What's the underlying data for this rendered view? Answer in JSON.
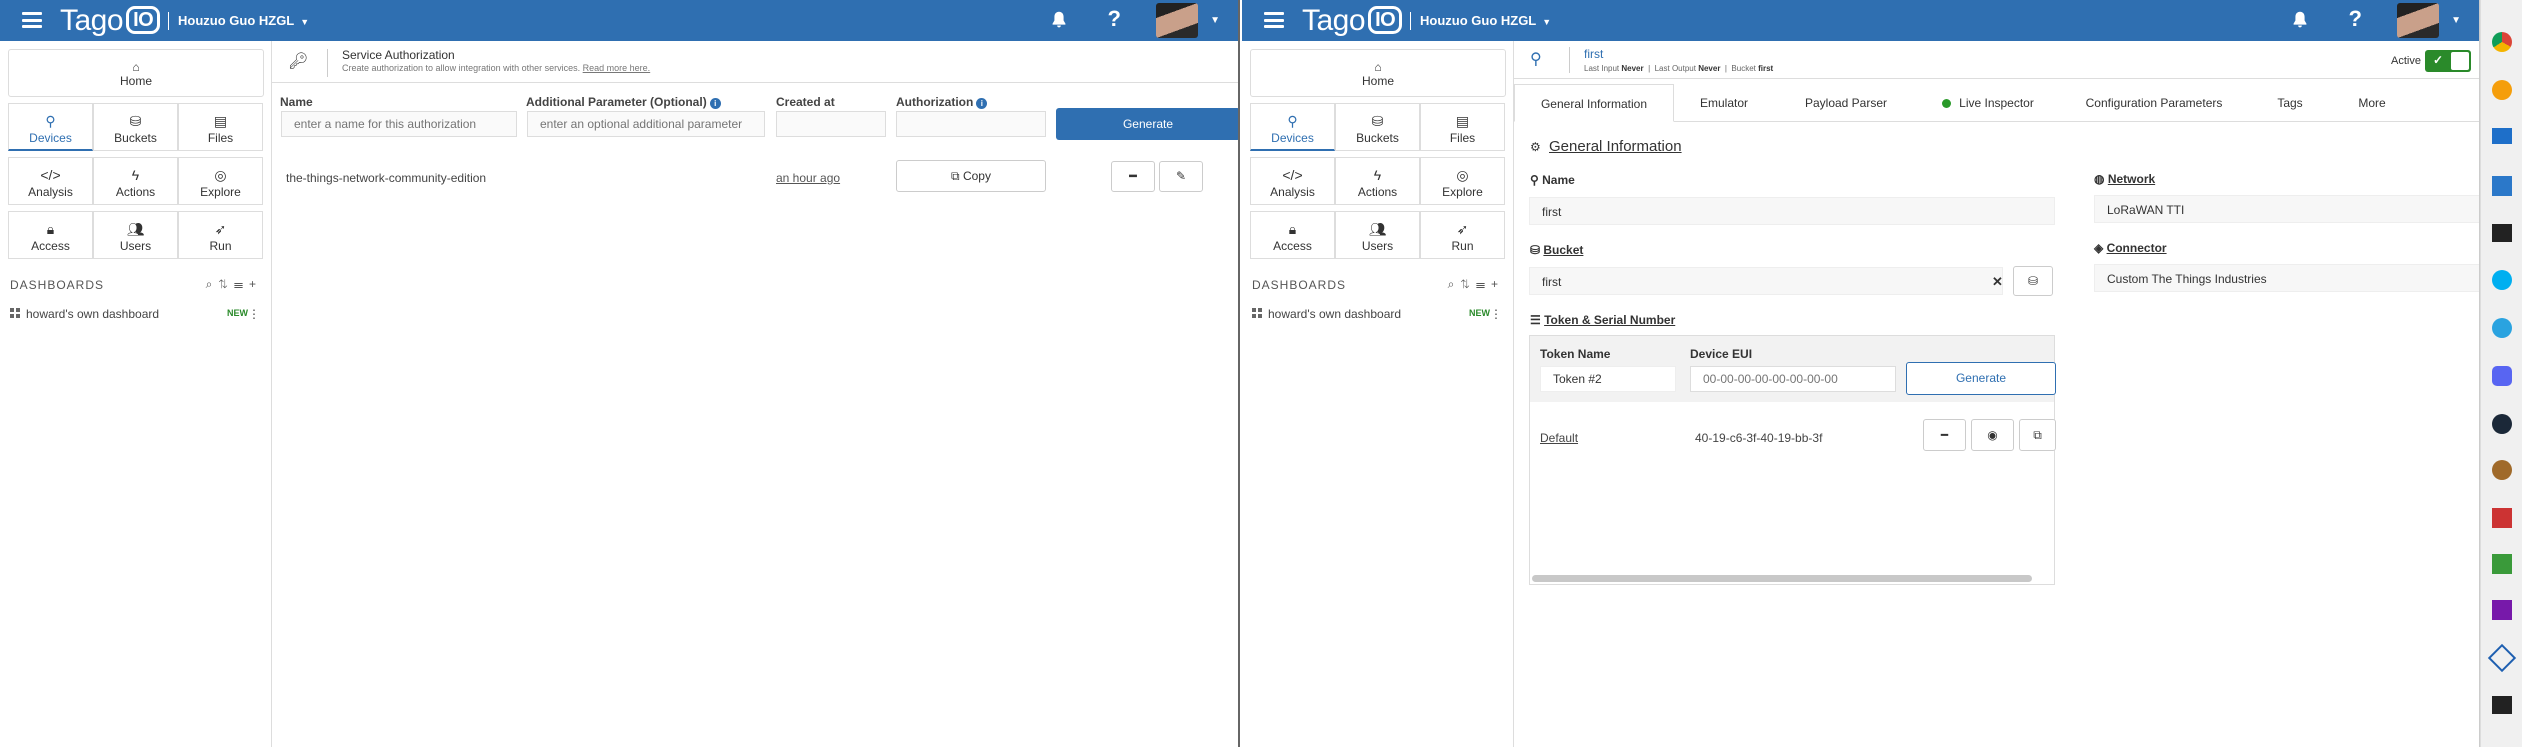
{
  "header": {
    "brand": "Tago",
    "brand_io": "IO",
    "tenant": "Houzuo Guo HZGL"
  },
  "sidebar": {
    "home": "Home",
    "tiles": [
      "Devices",
      "Buckets",
      "Files",
      "Analysis",
      "Actions",
      "Explore",
      "Access",
      "Users",
      "Run"
    ],
    "dashboards_title": "DASHBOARDS",
    "dashboard_item": "howard's own dashboard",
    "dashboard_badge": "NEW"
  },
  "service_auth": {
    "title": "Service Authorization",
    "subtitle": "Create authorization to allow integration with other services.",
    "read_more": "Read more here.",
    "labels": {
      "name": "Name",
      "additional": "Additional Parameter (Optional)",
      "created": "Created at",
      "authorization": "Authorization"
    },
    "placeholders": {
      "name": "enter a name for this authorization",
      "additional": "enter an optional additional parameter"
    },
    "generate": "Generate",
    "row": {
      "name": "the-things-network-community-edition",
      "created": "an hour ago",
      "copy": "Copy"
    }
  },
  "device": {
    "name": "first",
    "meta": {
      "last_input_label": "Last Input",
      "last_input": "Never",
      "last_output_label": "Last Output",
      "last_output": "Never",
      "bucket_label": "Bucket",
      "bucket": "first"
    },
    "active_label": "Active",
    "tabs": [
      "General Information",
      "Emulator",
      "Payload Parser",
      "Live Inspector",
      "Configuration Parameters",
      "Tags",
      "More"
    ],
    "section_title": "General Information",
    "name_label": "Name",
    "name_value": "first",
    "bucket_label": "Bucket",
    "bucket_value": "first",
    "token_label": "Token & Serial Number",
    "token_name_label": "Token Name",
    "device_eui_label": "Device EUI",
    "token_name_value": "Token #2",
    "device_eui_placeholder": "00-00-00-00-00-00-00-00",
    "generate": "Generate",
    "token_row": {
      "name": "Default",
      "value": "40-19-c6-3f-40-19-bb-3f"
    },
    "network_label": "Network",
    "network_value": "LoRaWAN TTI",
    "connector_label": "Connector",
    "connector_value": "Custom The Things Industries"
  },
  "colors": {
    "topbar": "#2f6fb1",
    "accent": "#2f6fb1",
    "active_toggle": "#2a8a2a"
  }
}
